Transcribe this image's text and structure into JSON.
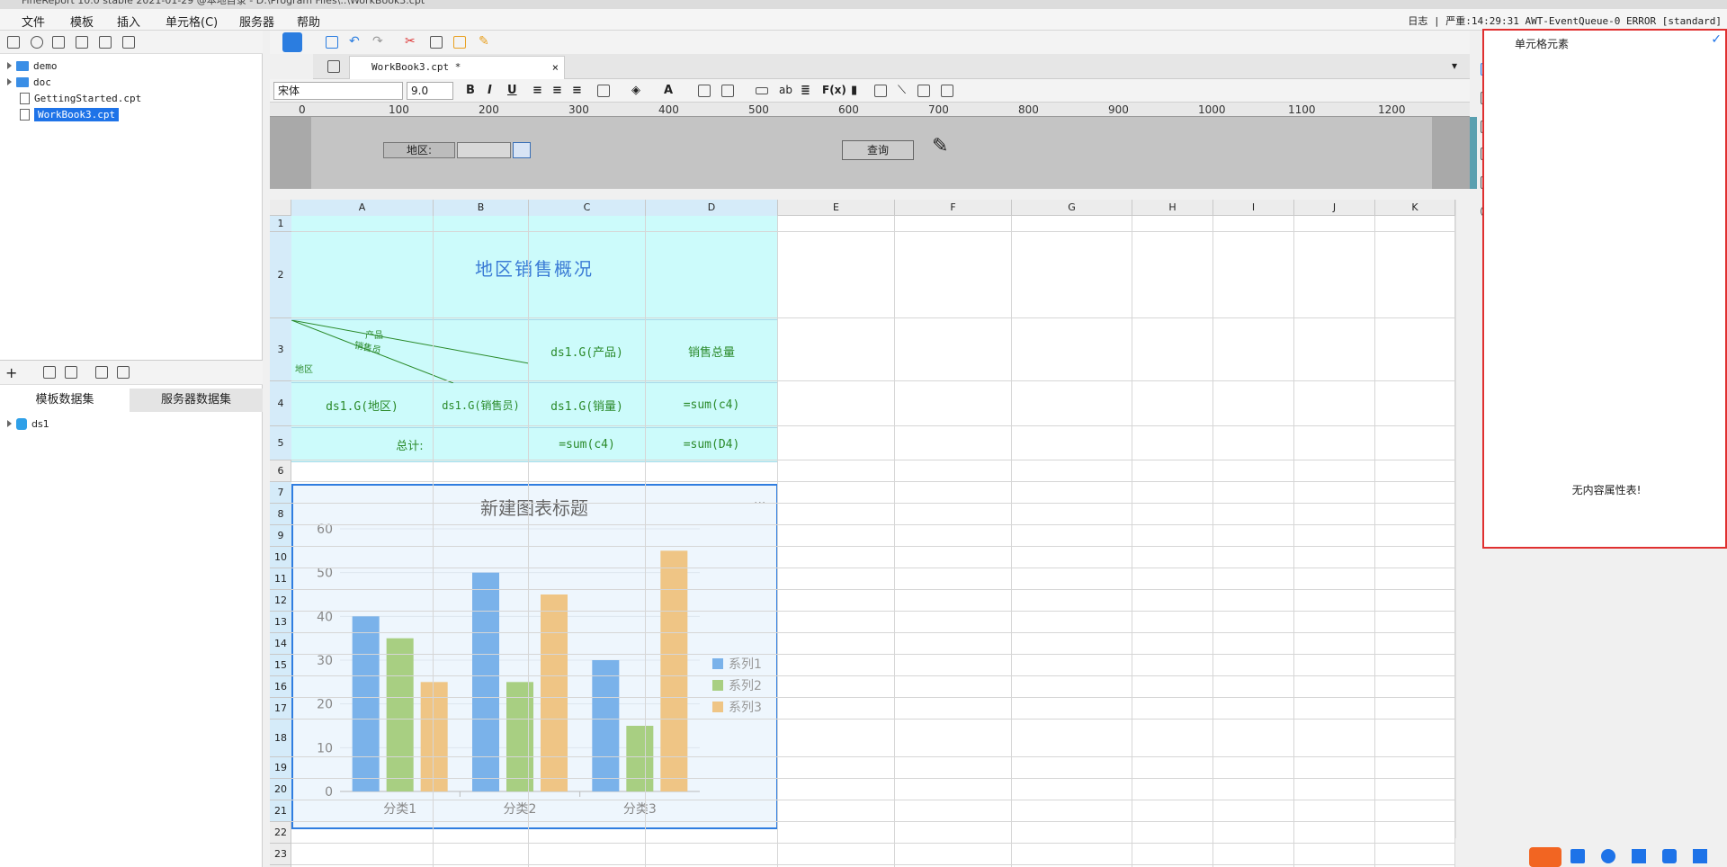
{
  "window": {
    "title": "FineReport 10.0 stable 2021-01-29 @本地目录 - D:\\Program Files\\..\\WorkBook3.cpt"
  },
  "menu": [
    "文件",
    "模板",
    "插入",
    "单元格(C)",
    "服务器",
    "帮助"
  ],
  "status": {
    "log_label": "日志",
    "log_text": "严重:14:29:31 AWT-EventQueue-0 ERROR [standard]"
  },
  "file_tree": [
    {
      "name": "demo",
      "type": "folder"
    },
    {
      "name": "doc",
      "type": "folder"
    },
    {
      "name": "GettingStarted.cpt",
      "type": "file"
    },
    {
      "name": "WorkBook3.cpt",
      "type": "file",
      "selected": true
    }
  ],
  "dataset_tabs": [
    "模板数据集",
    "服务器数据集"
  ],
  "datasets": [
    "ds1"
  ],
  "editor_tab": {
    "label": "WorkBook3.cpt *",
    "close": "×"
  },
  "format": {
    "font": "宋体",
    "size": "9.0"
  },
  "ruler": [
    "0",
    "100",
    "200",
    "300",
    "400",
    "500",
    "600",
    "700",
    "800",
    "900",
    "1000",
    "1100",
    "1200"
  ],
  "params": {
    "label": "地区:",
    "query_button": "查询"
  },
  "columns": [
    "A",
    "B",
    "C",
    "D",
    "E",
    "F",
    "G",
    "H",
    "I",
    "J",
    "K"
  ],
  "rows": [
    "1",
    "2",
    "3",
    "4",
    "5",
    "6",
    "7",
    "8",
    "9",
    "10",
    "11",
    "12",
    "13",
    "14",
    "15",
    "16",
    "17",
    "18",
    "19",
    "20",
    "21",
    "22",
    "23"
  ],
  "cells": {
    "title": "地区销售概况",
    "diag_product": "产品",
    "diag_seller": "销售员",
    "diag_region": "地区",
    "c3": "ds1.G(产品)",
    "d3": "销售总量",
    "a4": "ds1.G(地区)",
    "b4": "ds1.G(销售员)",
    "c4": "ds1.G(销量)",
    "d4": "=sum(c4)",
    "a5": "总计:",
    "c5": "=sum(c4)",
    "d5": "=sum(D4)"
  },
  "chart_data": {
    "type": "bar",
    "title": "新建图表标题",
    "categories": [
      "分类1",
      "分类2",
      "分类3"
    ],
    "series": [
      {
        "name": "系列1",
        "values": [
          40,
          50,
          30
        ],
        "color": "#7ab2ea"
      },
      {
        "name": "系列2",
        "values": [
          35,
          25,
          15
        ],
        "color": "#a8cf82"
      },
      {
        "name": "系列3",
        "values": [
          25,
          45,
          55
        ],
        "color": "#efc585"
      }
    ],
    "ylim": [
      0,
      60
    ],
    "yticks": [
      "0",
      "10",
      "20",
      "30",
      "40",
      "50",
      "60"
    ],
    "legend": "right",
    "grid": true,
    "menu": "···"
  },
  "right_panel": {
    "title": "单元格元素",
    "empty_text": "无内容属性表!",
    "check": "✓"
  }
}
